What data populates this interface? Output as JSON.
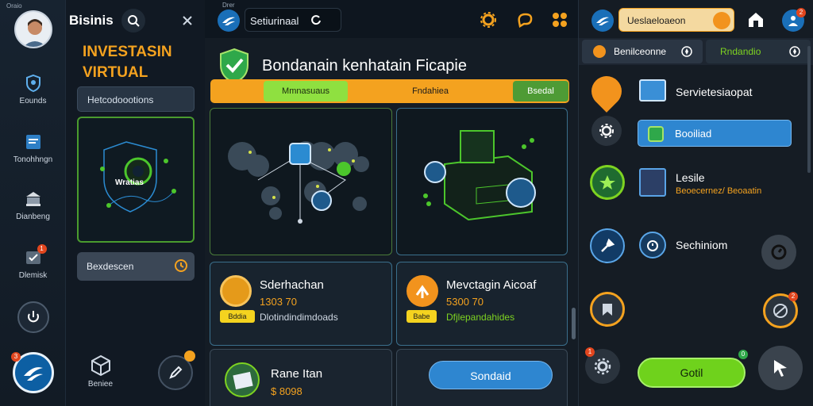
{
  "statusbar": {
    "left": "Oraio",
    "mid": "Drer"
  },
  "rail": {
    "items": [
      {
        "label": "Eounds"
      },
      {
        "label": "Tonohhngn"
      },
      {
        "label": "Dianbeng"
      },
      {
        "label": "Dlemisk"
      }
    ],
    "badge_bottom": "3",
    "badge_item": "1"
  },
  "col2": {
    "app_title": "Bisinis",
    "hero": "INVESTASIN\nVIRTUAL",
    "section": "Hetcodoootions",
    "card_label": "Wratias",
    "search_label": "Bexdescen",
    "bottom_label": "Beniee"
  },
  "topbar": {
    "search_value": "Setiurinaal"
  },
  "main": {
    "title": "Bondanain kenhatain Ficapie",
    "tabs": [
      {
        "label": "Mmnasuaus"
      },
      {
        "label": "Fndahiea"
      },
      {
        "label": "Bsedal"
      }
    ],
    "card_left": {
      "title": "Sderhachan",
      "price": "1303 70",
      "tag": "Bddia",
      "desc": "Dlotindindimdoads"
    },
    "card_right": {
      "title": "Mevctagin Aicoaf",
      "price": "5300 70",
      "tag": "Babe",
      "desc": "Dfjlepandahides"
    },
    "card_bottom": {
      "title": "Rane Itan",
      "price": "$ 8098"
    },
    "button": "Sondaid"
  },
  "right": {
    "top_title": "Ueslaeloaeon",
    "tab_a": "Benilceonne",
    "tab_b": "Rndandio",
    "row1": "Servietesiaopat",
    "row1_btn": "Booiliad",
    "row2_title": "Lesile",
    "row2_sub": "Beoecernez/ Beoaatin",
    "row3": "Sechiniom",
    "go_button": "Gotil",
    "badge_top": "2",
    "badge_a": "2",
    "badge_b": "1",
    "badge_c": "0"
  },
  "colors": {
    "accent_orange": "#f4a21f",
    "accent_green": "#7ed321",
    "accent_blue": "#1e90d6"
  }
}
